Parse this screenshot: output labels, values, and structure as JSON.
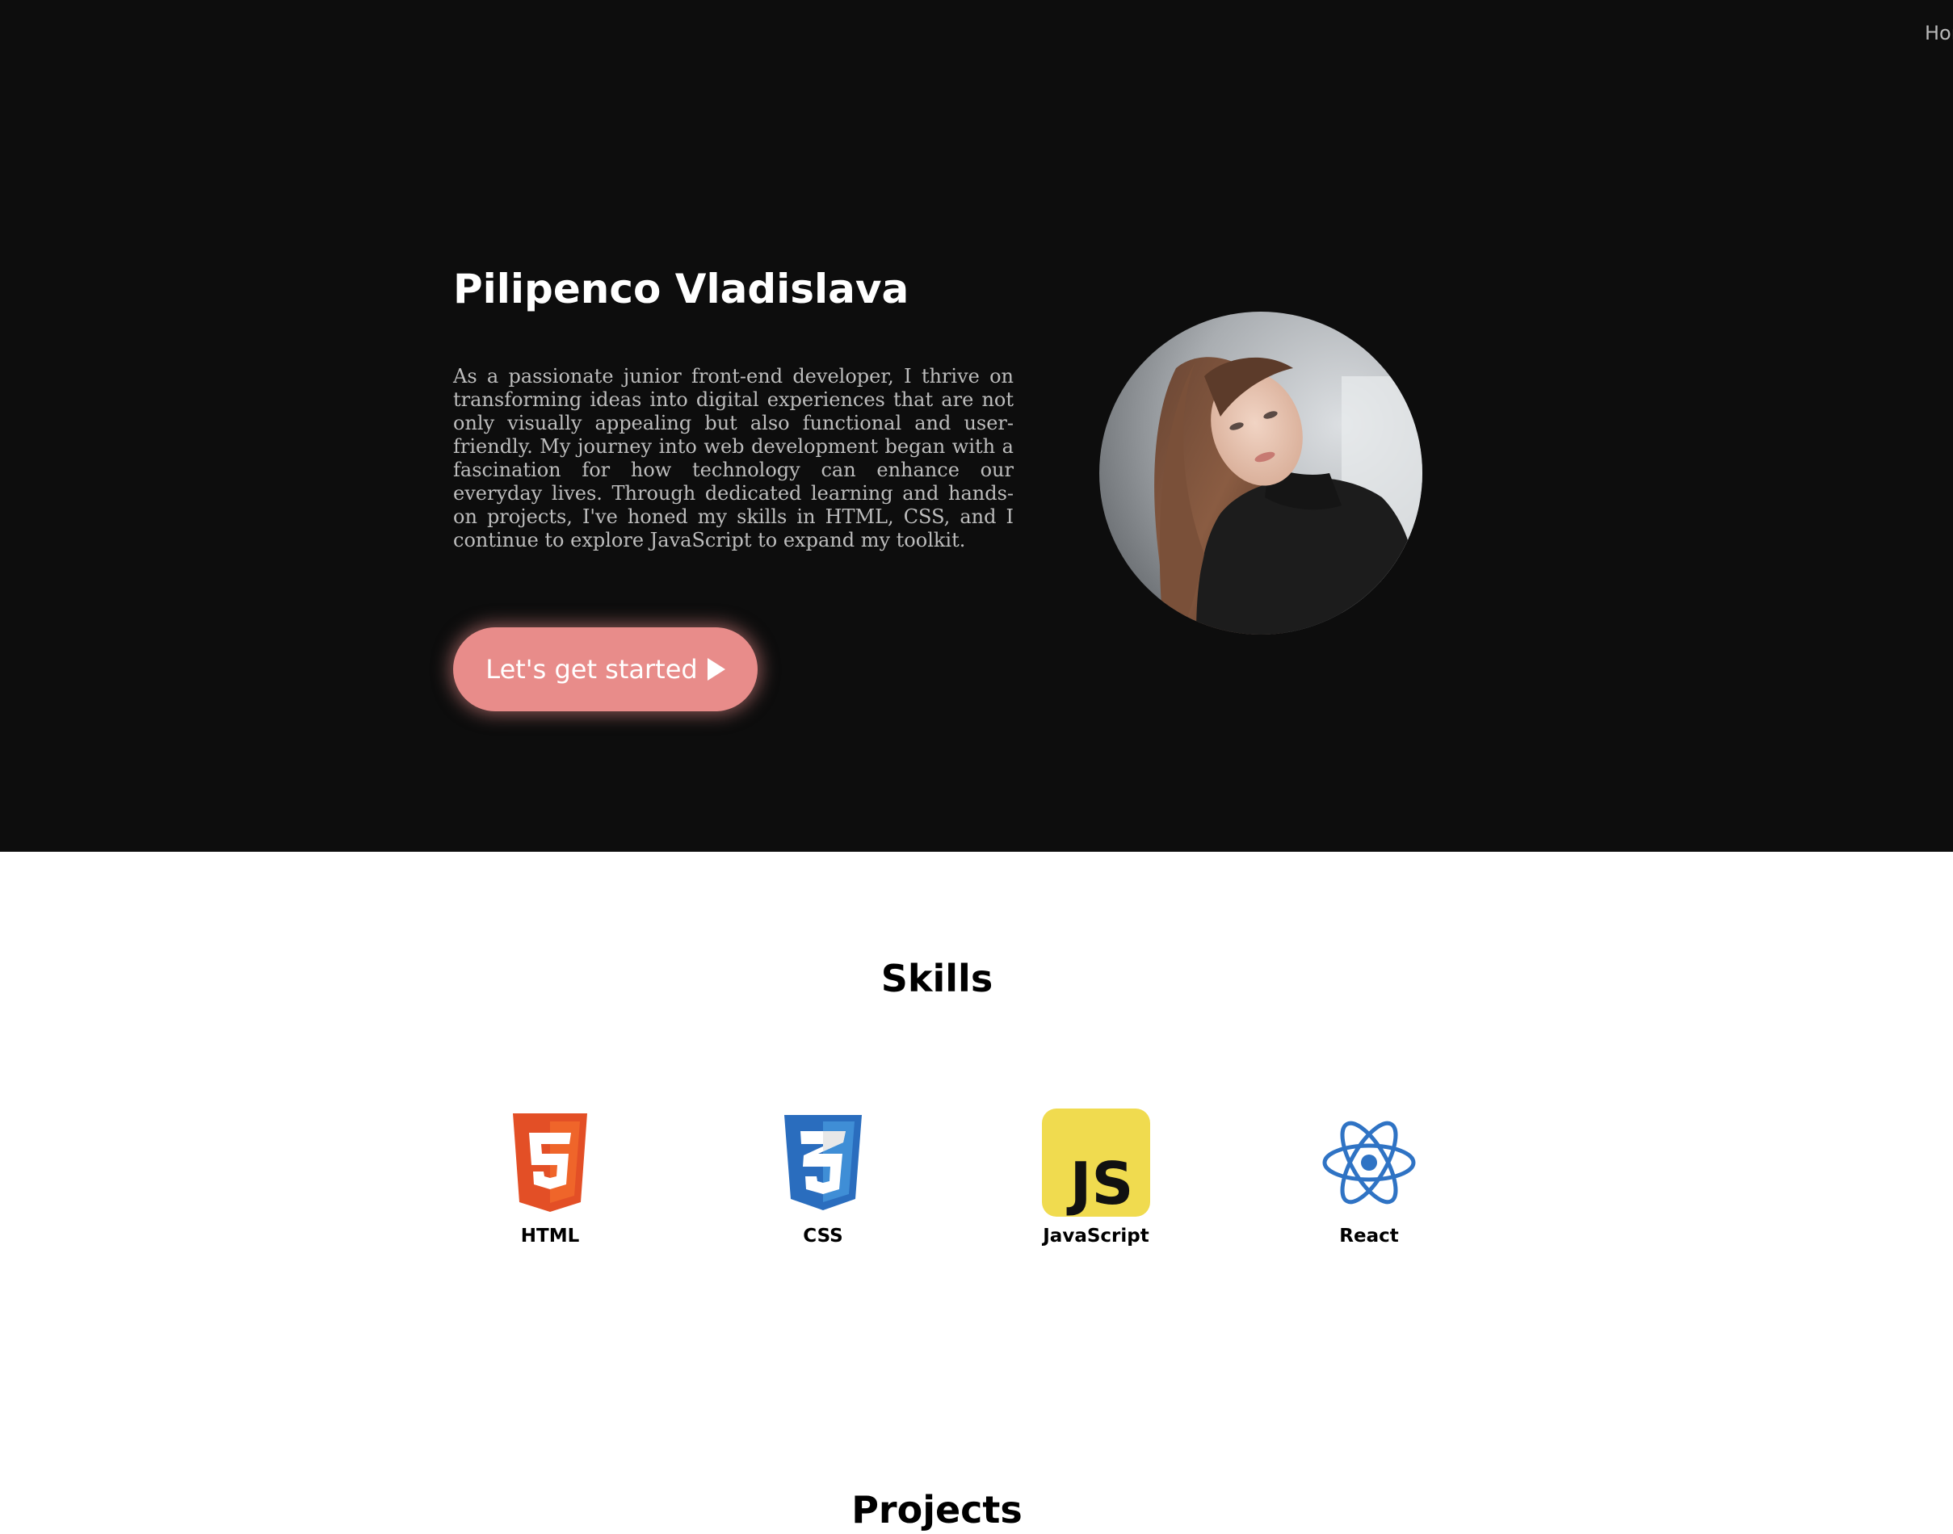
{
  "nav": {
    "home_label": "Home"
  },
  "hero": {
    "name": "Pilipenco Vladislava",
    "bio": "As a passionate junior front-end developer, I thrive on transforming ideas into digital experiences that are not only visually appealing but also functional and user-friendly. My journey into web development began with a fascination for how technology can enhance our everyday lives. Through dedicated learning and hands-on projects, I've honed my skills in HTML, CSS, and I continue to explore JavaScript to expand my toolkit.",
    "cta_label": "Let's get started",
    "cta_icon": "play-icon",
    "avatar_icon": "profile-photo"
  },
  "skills": {
    "title": "Skills",
    "items": [
      {
        "label": "HTML",
        "icon": "html5-icon"
      },
      {
        "label": "CSS",
        "icon": "css3-icon"
      },
      {
        "label": "JavaScript",
        "icon": "javascript-icon"
      },
      {
        "label": "React",
        "icon": "react-icon"
      }
    ]
  },
  "projects": {
    "title": "Projects"
  },
  "colors": {
    "hero_background": "#0d0d0d",
    "accent": "#e88c8a",
    "html": "#e34f26",
    "css": "#2965f1",
    "javascript": "#f0db4f",
    "react": "#2f73c4"
  }
}
